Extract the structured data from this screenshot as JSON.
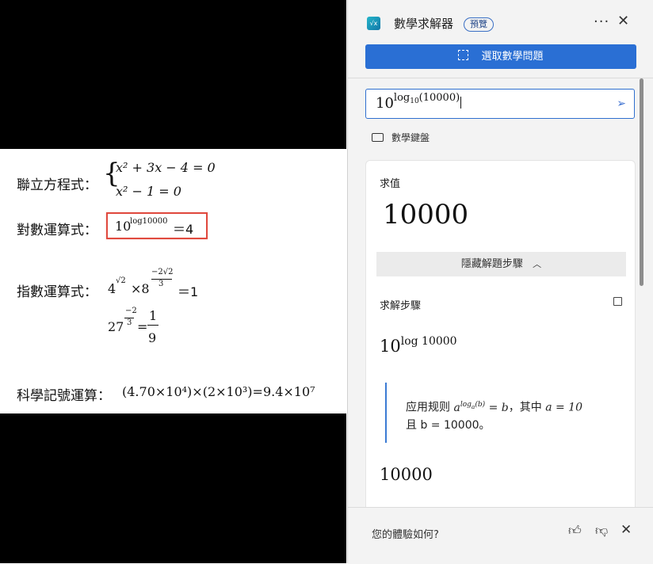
{
  "document": {
    "row1": {
      "label": "聯立方程式：",
      "eq1": "x² + 3x − 4 = 0",
      "eq2": "x² − 1 = 0"
    },
    "row2": {
      "label": "對數運算式：",
      "base": "10",
      "exponent": "log10000",
      "result": "＝4"
    },
    "row3": {
      "label": "指數運算式：",
      "a_base": "4",
      "a_exp": "√2",
      "times": "×8",
      "b_exp_num": "−2√2",
      "b_exp_den": "3",
      "eq": "＝1",
      "c_base": "27",
      "c_exp_num": "−2",
      "c_exp_den": "3",
      "c_eq": "=",
      "frac_num": "1",
      "frac_den": "9"
    },
    "row4": {
      "label": "科學記號運算：",
      "expr": "(4.70×10⁴)×(2×10³)=9.4×10⁷"
    }
  },
  "panel": {
    "app_title": "數學求解器",
    "preview_badge": "預覽",
    "more_icon": "more-icon",
    "close_icon": "close-icon",
    "select_button": "選取數學問題",
    "input": {
      "base": "10",
      "log": "log",
      "sub": "10",
      "arg": "(10000)"
    },
    "keyboard_label": "數學鍵盤",
    "card": {
      "eval_label": "求值",
      "result": "10000",
      "hide_steps": "隱藏解題步驟",
      "steps_label": "求解步驟",
      "step_expr_base": "10",
      "step_expr_exp": "log 10000",
      "rule_line1_a": "应用规则 ",
      "rule_line1_b": "，其中 ",
      "rule_line2": "且 b = 10000。",
      "step_result": "10000"
    },
    "feedback": {
      "question": "您的體驗如何?"
    }
  }
}
